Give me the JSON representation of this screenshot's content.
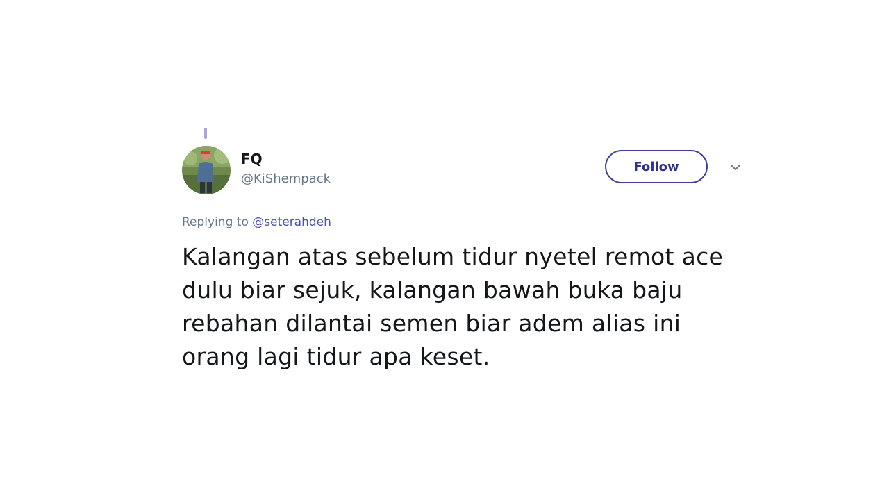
{
  "tweet": {
    "display_name": "FQ",
    "handle": "@KiShempack",
    "follow_label": "Follow",
    "replying_prefix": "Replying to",
    "replying_to": "@seterahdeh",
    "text_lines": [
      "Kalangan atas sebelum tidur nyetel remot ace",
      "dulu biar sejuk, kalangan bawah buka baju",
      "rebahan dilantai semen biar adem alias ini",
      "orang lagi tidur apa keset."
    ]
  },
  "icons": {
    "more": "chevron-down-icon",
    "avatar": "profile-photo"
  },
  "colors": {
    "accent": "#2e3192",
    "muted": "#657786",
    "text": "#14171a",
    "thread_line": "#a8a3e0"
  }
}
